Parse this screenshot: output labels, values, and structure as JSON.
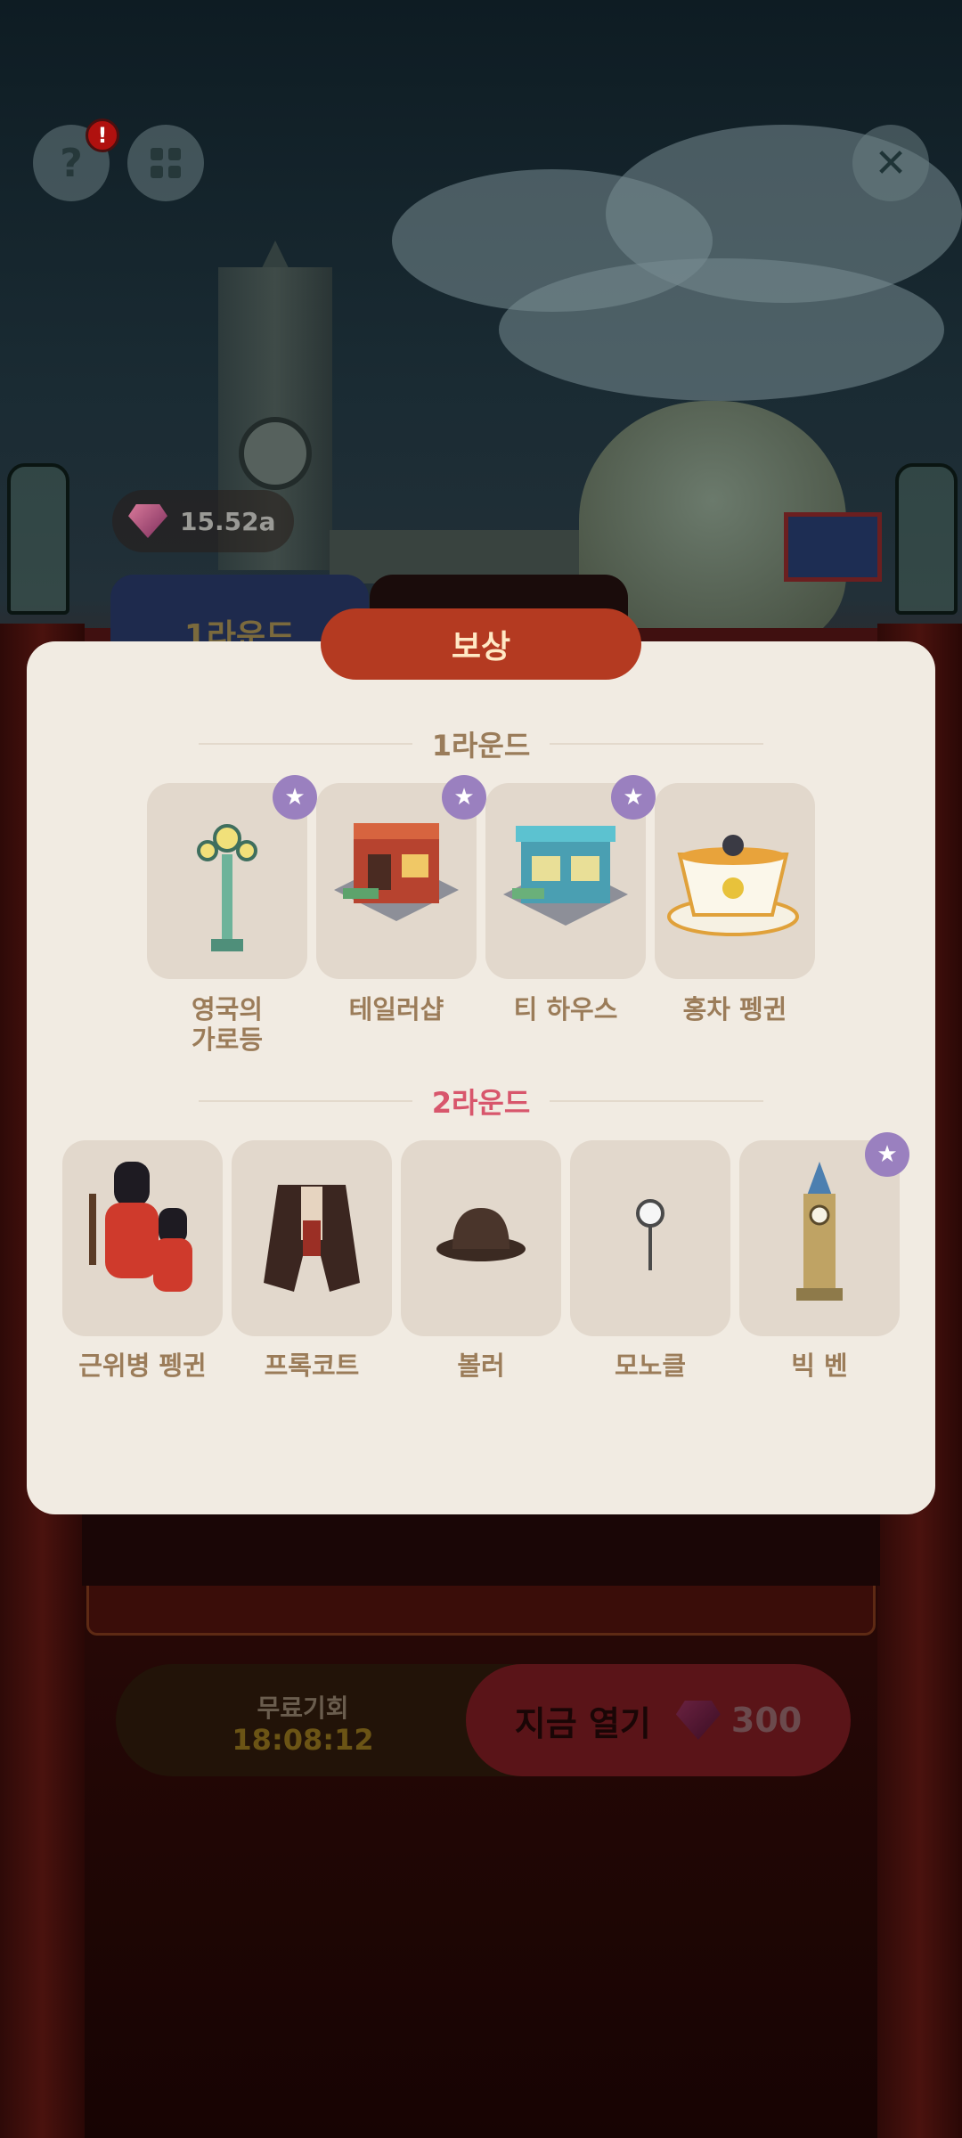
{
  "top_bar": {
    "help_icon": "?",
    "alert_badge": "!",
    "close_icon": "✕"
  },
  "currency": {
    "value": "15.52a",
    "icon": "gem-icon"
  },
  "tabs": [
    {
      "label": "1라운드"
    },
    {
      "label": ""
    }
  ],
  "modal": {
    "title": "보상",
    "sections": [
      {
        "title": "1라운드",
        "items": [
          {
            "label": "영국의\n가로등",
            "starred": true,
            "icon": "street-lamp-icon"
          },
          {
            "label": "테일러샵",
            "starred": true,
            "icon": "tailor-shop-icon"
          },
          {
            "label": "티 하우스",
            "starred": true,
            "icon": "tea-house-icon"
          },
          {
            "label": "홍차 펭귄",
            "starred": false,
            "icon": "tea-penguin-icon"
          }
        ]
      },
      {
        "title": "2라운드",
        "items": [
          {
            "label": "근위병 펭귄",
            "starred": false,
            "icon": "guard-penguin-icon"
          },
          {
            "label": "프록코트",
            "starred": false,
            "icon": "frock-coat-icon"
          },
          {
            "label": "볼러",
            "starred": false,
            "icon": "bowler-hat-icon"
          },
          {
            "label": "모노클",
            "starred": false,
            "icon": "monocle-icon"
          },
          {
            "label": "빅 벤",
            "starred": true,
            "icon": "big-ben-icon"
          }
        ]
      }
    ],
    "star_icon": "★"
  },
  "bottom": {
    "free_label": "무료기회",
    "free_timer": "18:08:12",
    "open_label": "지금 열기",
    "open_price": "300"
  }
}
